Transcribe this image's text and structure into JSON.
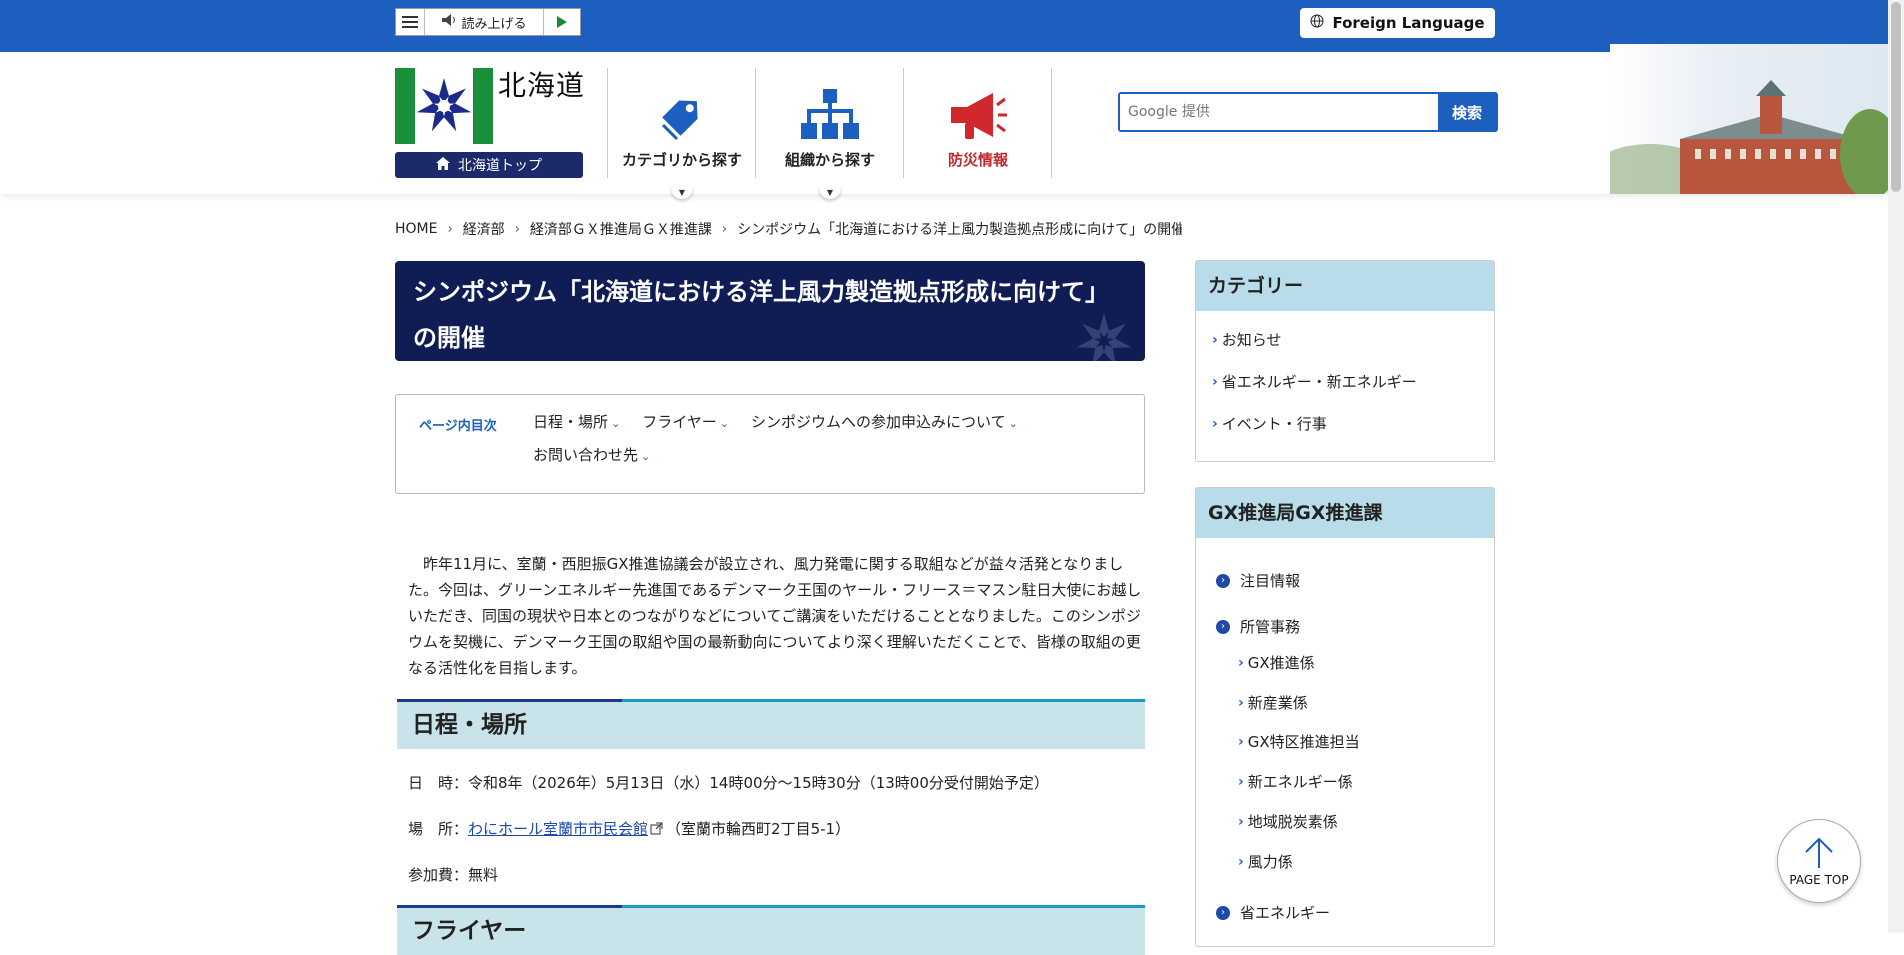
{
  "toolbar": {
    "read_aloud": "読み上げる"
  },
  "foreign_language": "Foreign Language",
  "logo": {
    "name": "北海道",
    "top_link": "北海道トップ"
  },
  "nav": [
    {
      "label": "カテゴリから探す",
      "icon": "tag-icon"
    },
    {
      "label": "組織から探す",
      "icon": "org-chart-icon"
    },
    {
      "label": "防災情報",
      "icon": "megaphone-icon"
    }
  ],
  "search": {
    "placeholder": "Google 提供",
    "button": "検索"
  },
  "breadcrumb": [
    "HOME",
    "経済部",
    "経済部ＧＸ推進局ＧＸ推進課",
    "シンポジウム「北海道における洋上風力製造拠点形成に向けて」の開催"
  ],
  "page_title": "シンポジウム「北海道における洋上風力製造拠点形成に向けて」の開催",
  "toc": {
    "label": "ページ内目次",
    "items": [
      "日程・場所",
      "フライヤー",
      "シンポジウムへの参加申込みについて",
      "お問い合わせ先"
    ]
  },
  "intro": "　昨年11月に、室蘭・西胆振GX推進協議会が設立され、風力発電に関する取組などが益々活発となりました。今回は、グリーンエネルギー先進国であるデンマーク王国のヤール・フリース＝マスン駐日大使にお越しいただき、同国の現状や日本とのつながりなどについてご講演をいただけることとなりました。このシンポジウムを契機に、デンマーク王国の取組や国の最新動向についてより深く理解いただくことで、皆様の取組の更なる活性化を目指します。",
  "sections": {
    "schedule": "日程・場所",
    "flyer": "フライヤー"
  },
  "schedule": {
    "date_label": "日　時：",
    "date_value": "令和8年（2026年）5月13日（水）14時00分～15時30分（13時00分受付開始予定）",
    "place_label": "場　所：",
    "place_link": "わにホール室蘭市市民会館",
    "place_address": "（室蘭市輪西町2丁目5-1）",
    "fee_label": "参加費：",
    "fee_value": "無料"
  },
  "sidebar": {
    "category": {
      "title": "カテゴリー",
      "items": [
        "お知らせ",
        "省エネルギー・新エネルギー",
        "イベント・行事"
      ]
    },
    "dept": {
      "title": "GX推進局GX推進課",
      "items": [
        "注目情報",
        "所管事務"
      ],
      "sub_items": [
        "GX推進係",
        "新産業係",
        "GX特区推進担当",
        "新エネルギー係",
        "地域脱炭素係",
        "風力係"
      ],
      "last_item": "省エネルギー"
    }
  },
  "page_top": "PAGE TOP",
  "colors": {
    "brand_blue": "#1d5fbf",
    "title_navy": "#0f1d54",
    "section_bg": "#c8e4ea",
    "side_header_bg": "#b9dcea"
  }
}
